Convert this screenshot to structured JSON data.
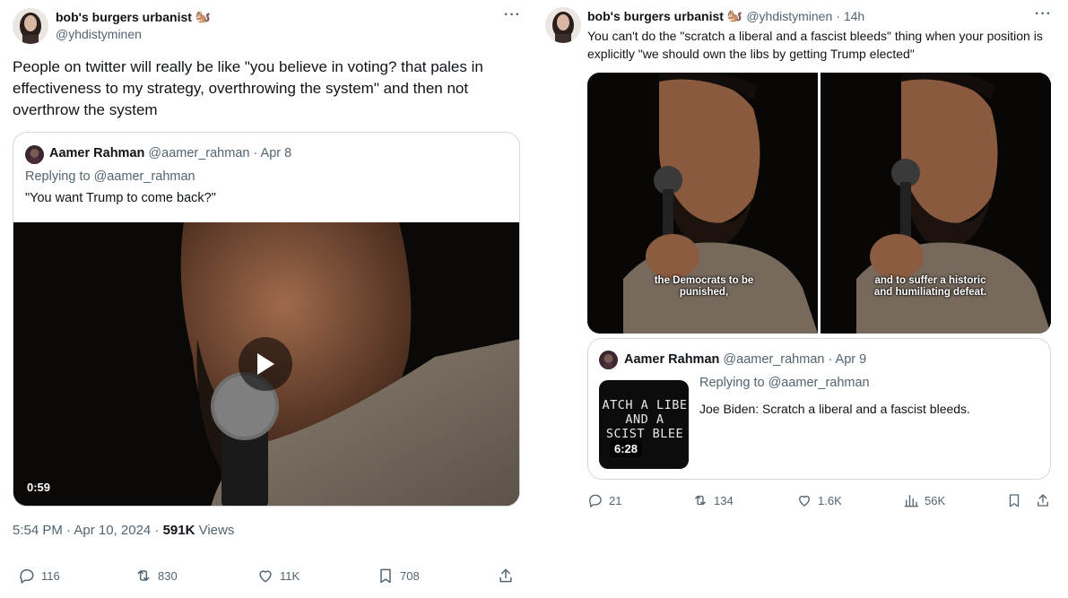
{
  "left_tweet": {
    "author_name": "bob's burgers urbanist",
    "author_handle": "@yhdistyminen",
    "text": "People on twitter will really be like \"you believe in voting? that pales in effectiveness to my strategy, overthrowing the system\" and then not overthrow the system",
    "quote": {
      "author_name": "Aamer Rahman",
      "author_handle": "@aamer_rahman",
      "date": "· Apr 8",
      "replying_to": "Replying to @aamer_rahman",
      "text": "\"You want Trump to come back?\"",
      "video_duration": "0:59"
    },
    "timestamp": "5:54 PM · Apr 10, 2024 · ",
    "views_count": "591K",
    "views_label": " Views",
    "actions": {
      "replies": "116",
      "retweets": "830",
      "likes": "11K",
      "bookmarks": "708"
    }
  },
  "right_tweet": {
    "author_name": "bob's burgers urbanist",
    "author_handle": "@yhdistyminen",
    "time": "· 14h",
    "text": "You can't do the \"scratch a liberal and a fascist bleeds\" thing when your position is explicitly \"we should own the libs by getting Trump elected\"",
    "media_caption_left": "the Democrats to be punished,",
    "media_caption_right": "and to suffer a historic and humiliating defeat.",
    "quote": {
      "author_name": "Aamer Rahman",
      "author_handle": "@aamer_rahman",
      "date": "· Apr 9",
      "replying_to": "Replying to @aamer_rahman",
      "text": "Joe Biden: Scratch a liberal and a fascist bleeds.",
      "thumb_line1": "ATCH A LIBE",
      "thumb_line2": "AND A",
      "thumb_line3": "SCIST BLEE",
      "video_duration": "6:28"
    },
    "actions": {
      "replies": "21",
      "retweets": "134",
      "likes": "1.6K",
      "views": "56K"
    }
  },
  "emoji": "🐿️",
  "colors": {
    "text_primary": "#0f1419",
    "text_secondary": "#536471",
    "border": "#cfd9de"
  }
}
